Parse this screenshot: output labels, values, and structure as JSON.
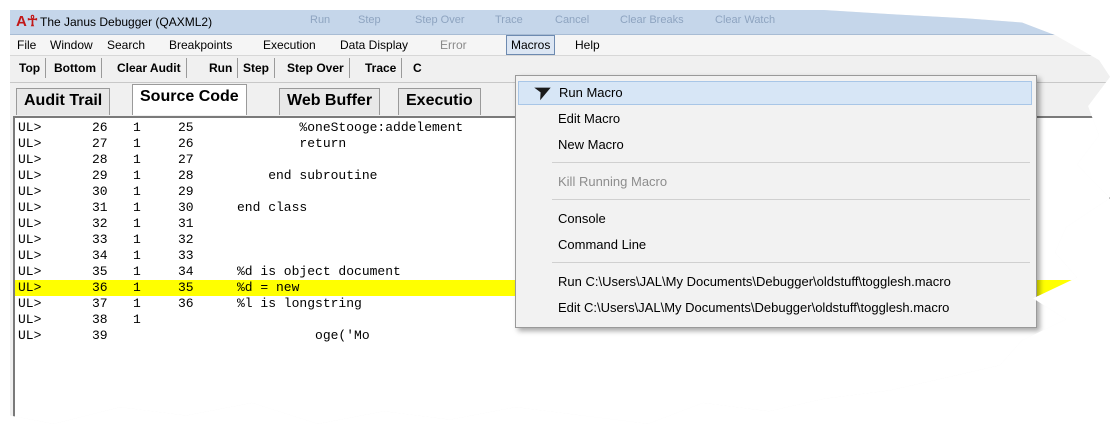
{
  "window": {
    "logo": "A☥",
    "title": "The Janus Debugger (QAXML2)",
    "title_ghost": [
      "Run",
      "Step",
      "Step Over",
      "Trace",
      "Cancel",
      "Clear Breaks",
      "Clear Watch"
    ]
  },
  "menubar": {
    "items": [
      {
        "label": "File"
      },
      {
        "label": "Window"
      },
      {
        "label": "Search"
      },
      {
        "label": "Breakpoints"
      },
      {
        "label": "Execution"
      },
      {
        "label": "Data Display"
      },
      {
        "label": "Error"
      },
      {
        "label": "Macros"
      },
      {
        "label": "Help"
      }
    ]
  },
  "toolbar": {
    "buttons": [
      {
        "label": "Top"
      },
      {
        "label": "Bottom"
      },
      {
        "label": "Clear Audit"
      },
      {
        "label": "Run"
      },
      {
        "label": "Step"
      },
      {
        "label": "Step Over"
      },
      {
        "label": "Trace"
      },
      {
        "label": "C"
      }
    ]
  },
  "tabs": [
    {
      "label": "Audit Trail"
    },
    {
      "label": "Source Code"
    },
    {
      "label": "Web Buffer"
    },
    {
      "label": "Executio"
    }
  ],
  "source": {
    "highlight_color": "#ffff00",
    "rows": [
      {
        "prefix": "UL>",
        "a": "26",
        "b": "1",
        "c": "25",
        "code": "        %oneStooge:addelement"
      },
      {
        "prefix": "UL>",
        "a": "27",
        "b": "1",
        "c": "26",
        "code": "        return"
      },
      {
        "prefix": "UL>",
        "a": "28",
        "b": "1",
        "c": "27",
        "code": ""
      },
      {
        "prefix": "UL>",
        "a": "29",
        "b": "1",
        "c": "28",
        "code": "    end subroutine"
      },
      {
        "prefix": "UL>",
        "a": "30",
        "b": "1",
        "c": "29",
        "code": ""
      },
      {
        "prefix": "UL>",
        "a": "31",
        "b": "1",
        "c": "30",
        "code": "end class"
      },
      {
        "prefix": "UL>",
        "a": "32",
        "b": "1",
        "c": "31",
        "code": ""
      },
      {
        "prefix": "UL>",
        "a": "33",
        "b": "1",
        "c": "32",
        "code": ""
      },
      {
        "prefix": "UL>",
        "a": "34",
        "b": "1",
        "c": "33",
        "code": ""
      },
      {
        "prefix": "UL>",
        "a": "35",
        "b": "1",
        "c": "34",
        "code": "%d is object document"
      },
      {
        "prefix": "UL>",
        "a": "36",
        "b": "1",
        "c": "35",
        "code": "%d = new"
      },
      {
        "prefix": "UL>",
        "a": "37",
        "b": "1",
        "c": "36",
        "code": "%l is longstring"
      },
      {
        "prefix": "UL>",
        "a": "38",
        "b": "1",
        "c": "",
        "code": ""
      },
      {
        "prefix": "UL>",
        "a": "39",
        "b": "",
        "c": "",
        "code": "          oge('Mo"
      }
    ]
  },
  "macros_menu": {
    "run_macro": "Run Macro",
    "edit_macro": "Edit Macro",
    "new_macro": "New Macro",
    "kill_running_macro": "Kill Running Macro",
    "console": "Console",
    "command_line": "Command Line",
    "recent_run": "Run C:\\Users\\JAL\\My Documents\\Debugger\\oldstuff\\togglesh.macro",
    "recent_edit": "Edit C:\\Users\\JAL\\My Documents\\Debugger\\oldstuff\\togglesh.macro"
  }
}
